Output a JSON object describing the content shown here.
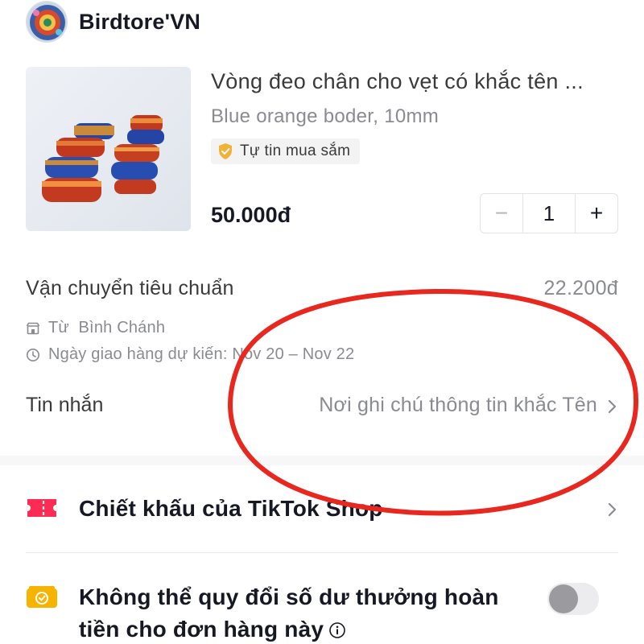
{
  "shop": {
    "name": "Birdtore'VN"
  },
  "product": {
    "title": "Vòng đeo chân cho vẹt có khắc tên ...",
    "variant": "Blue orange boder, 10mm",
    "badge": "Tự tin mua sắm",
    "price": "50.000đ",
    "quantity": "1",
    "minus_symbol": "−",
    "plus_symbol": "+"
  },
  "shipping": {
    "method": "Vận chuyển tiêu chuẩn",
    "fee": "22.200đ",
    "from": "Từ  Bình Chánh",
    "delivery": "Ngày giao hàng dự kiến: Nov 20 – Nov 22"
  },
  "message": {
    "label": "Tin nhắn",
    "placeholder": "Nơi ghi chú thông tin khắc Tên"
  },
  "discount": {
    "label": "Chiết khấu của TikTok Shop"
  },
  "rewards": {
    "text": "Không thể quy đổi số dư thưởng hoàn tiền cho đơn hàng này",
    "enabled": false
  },
  "icons": {
    "shop_avatar": "shop-avatar-image",
    "badge": "shield-check-icon",
    "from": "store-icon",
    "delivery": "clock-icon",
    "message": "chevron-right-icon",
    "discount": "ticket-icon",
    "rewards": "coin-icon",
    "info": "info-icon"
  },
  "colors": {
    "accent_red": "#fe2c55",
    "annotation_red": "#e8281e",
    "rewards_yellow": "#f6b400",
    "badge_gold": "#f4b13a",
    "text_primary": "#161823",
    "text_secondary": "#8a8b91"
  }
}
